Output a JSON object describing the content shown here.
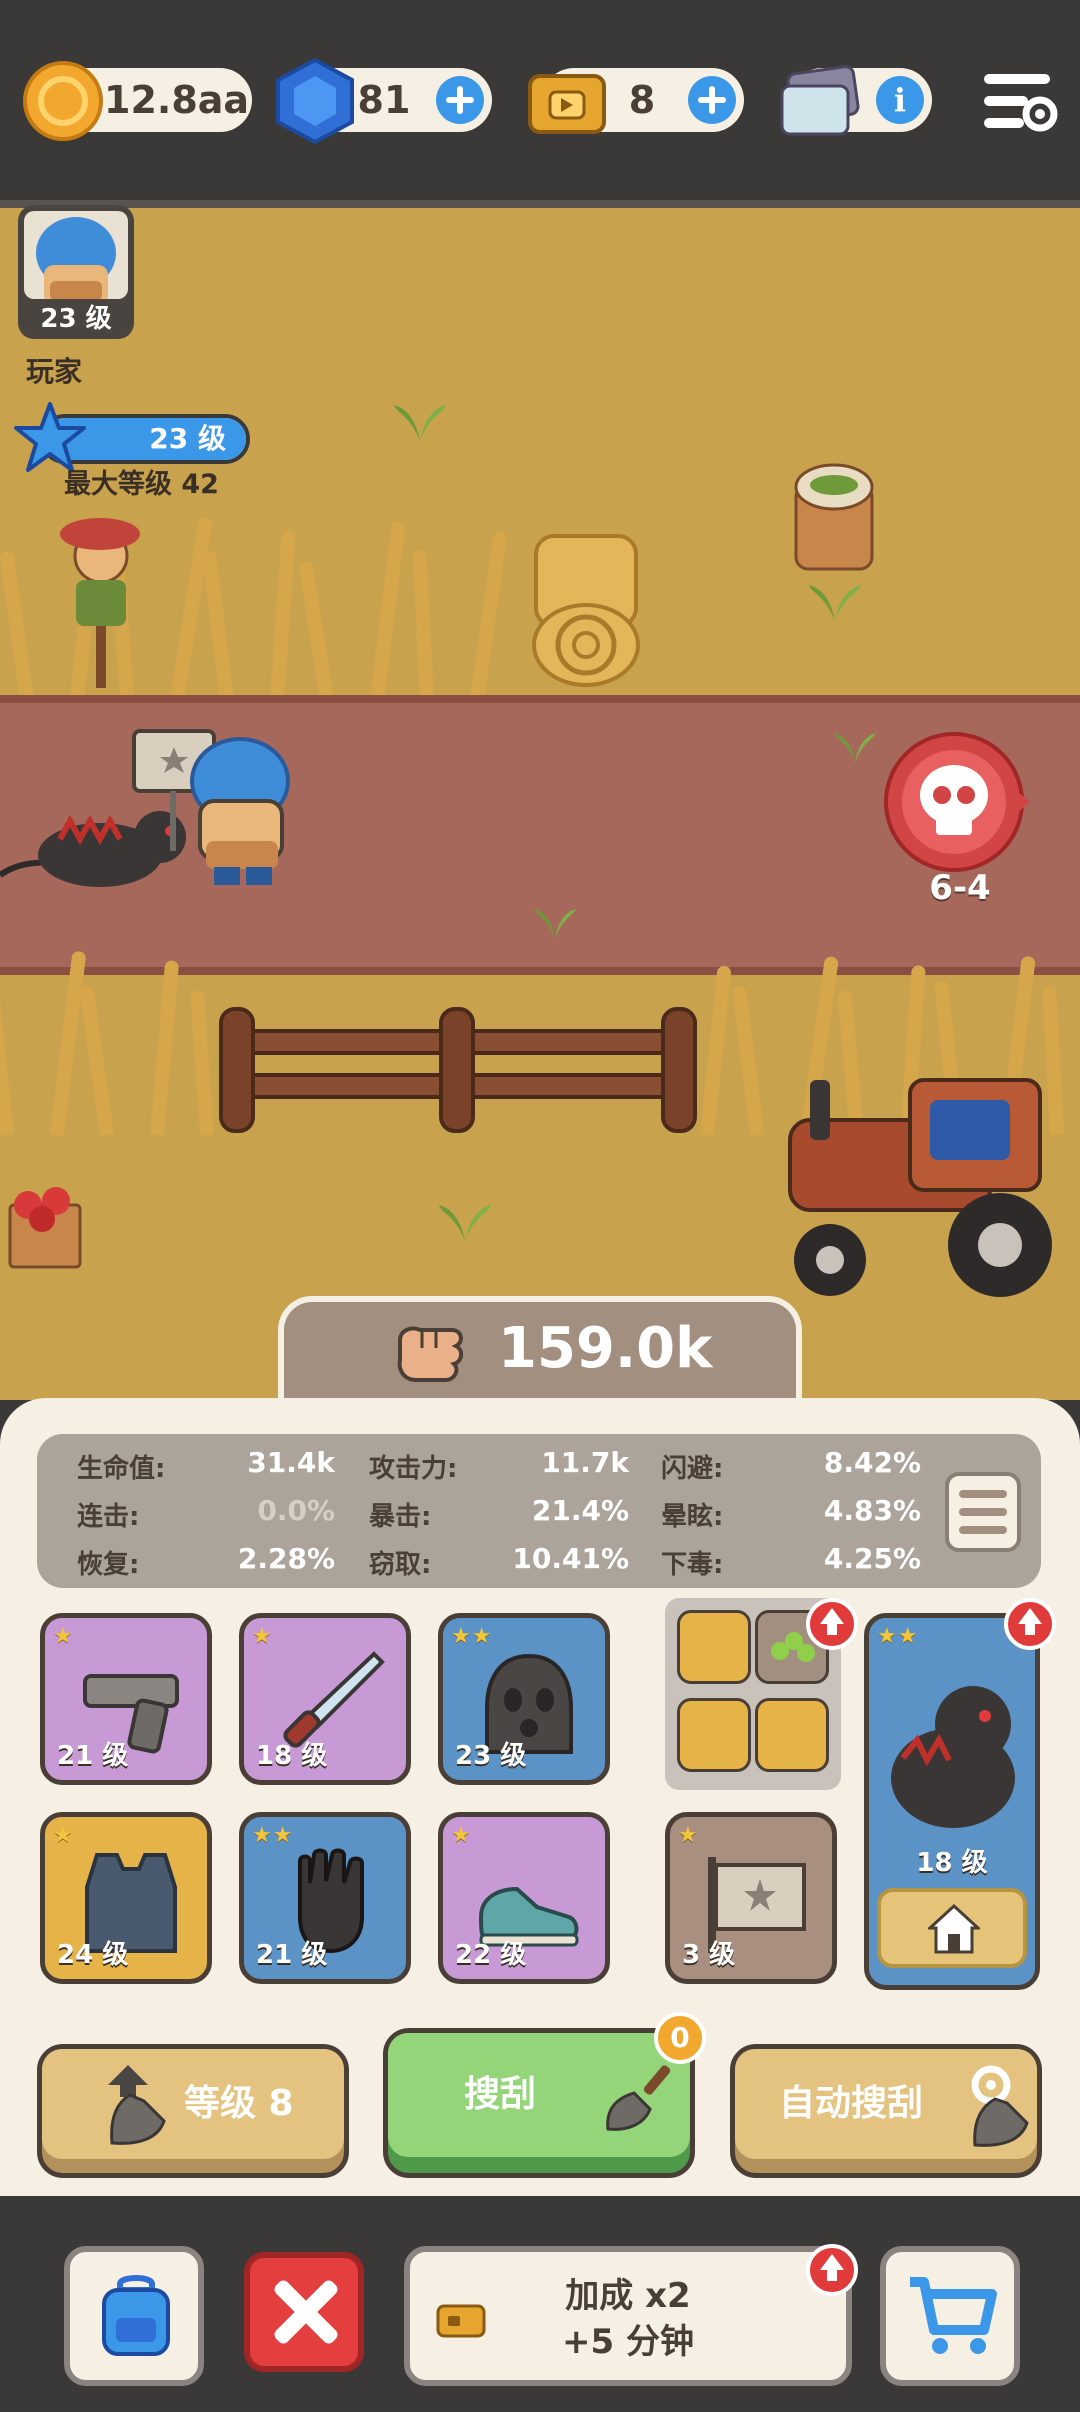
{
  "topbar": {
    "gold_amount": "12.8aa",
    "gem_amount": "81",
    "ticket_amount": "8",
    "card_amount": "",
    "icons": [
      "gold-coin-icon",
      "gem-icon",
      "ticket-icon",
      "card-icon",
      "settings-icon"
    ]
  },
  "player": {
    "card_level": "23 级",
    "name": "玩家",
    "xp_level": "23 级",
    "max_level": "最大等级 42"
  },
  "stage": {
    "label": "6-4"
  },
  "power": {
    "value": "159.0k"
  },
  "stats": [
    {
      "label": "生命值:",
      "value": "31.4k"
    },
    {
      "label": "攻击力:",
      "value": "11.7k"
    },
    {
      "label": "闪避:",
      "value": "8.42%"
    },
    {
      "label": "连击:",
      "value": "0.0%"
    },
    {
      "label": "暴击:",
      "value": "21.4%"
    },
    {
      "label": "晕眩:",
      "value": "4.83%"
    },
    {
      "label": "恢复:",
      "value": "2.28%"
    },
    {
      "label": "窃取:",
      "value": "10.41%"
    },
    {
      "label": "下毒:",
      "value": "4.25%"
    }
  ],
  "equipment": [
    {
      "slot": "weapon-pistol",
      "level": "21 级",
      "stars": "★"
    },
    {
      "slot": "weapon-knife",
      "level": "18 级",
      "stars": "★"
    },
    {
      "slot": "head-mask",
      "level": "23 级",
      "stars": "★★"
    },
    {
      "slot": "body-vest",
      "level": "24 级",
      "stars": "★"
    },
    {
      "slot": "gloves",
      "level": "21 级",
      "stars": "★★"
    },
    {
      "slot": "shoes",
      "level": "22 级",
      "stars": "★"
    },
    {
      "slot": "banner",
      "level": "3 级",
      "stars": "★"
    }
  ],
  "pet": {
    "level": "18 级",
    "stars": "★★"
  },
  "actions": {
    "level_label": "等级 8",
    "loot_label": "搜刮",
    "loot_count": "0",
    "auto_label": "自动搜刮"
  },
  "bottomnav": {
    "bonus_line1": "加成 x2",
    "bonus_line2": "+5 分钟"
  },
  "colors": {
    "accent_blue": "#3b97e8",
    "panel_bg": "#f6efe4",
    "field": "#c9a24d",
    "road": "#a6685a",
    "loot_green": "#95d579",
    "close_red": "#e53e3e"
  }
}
